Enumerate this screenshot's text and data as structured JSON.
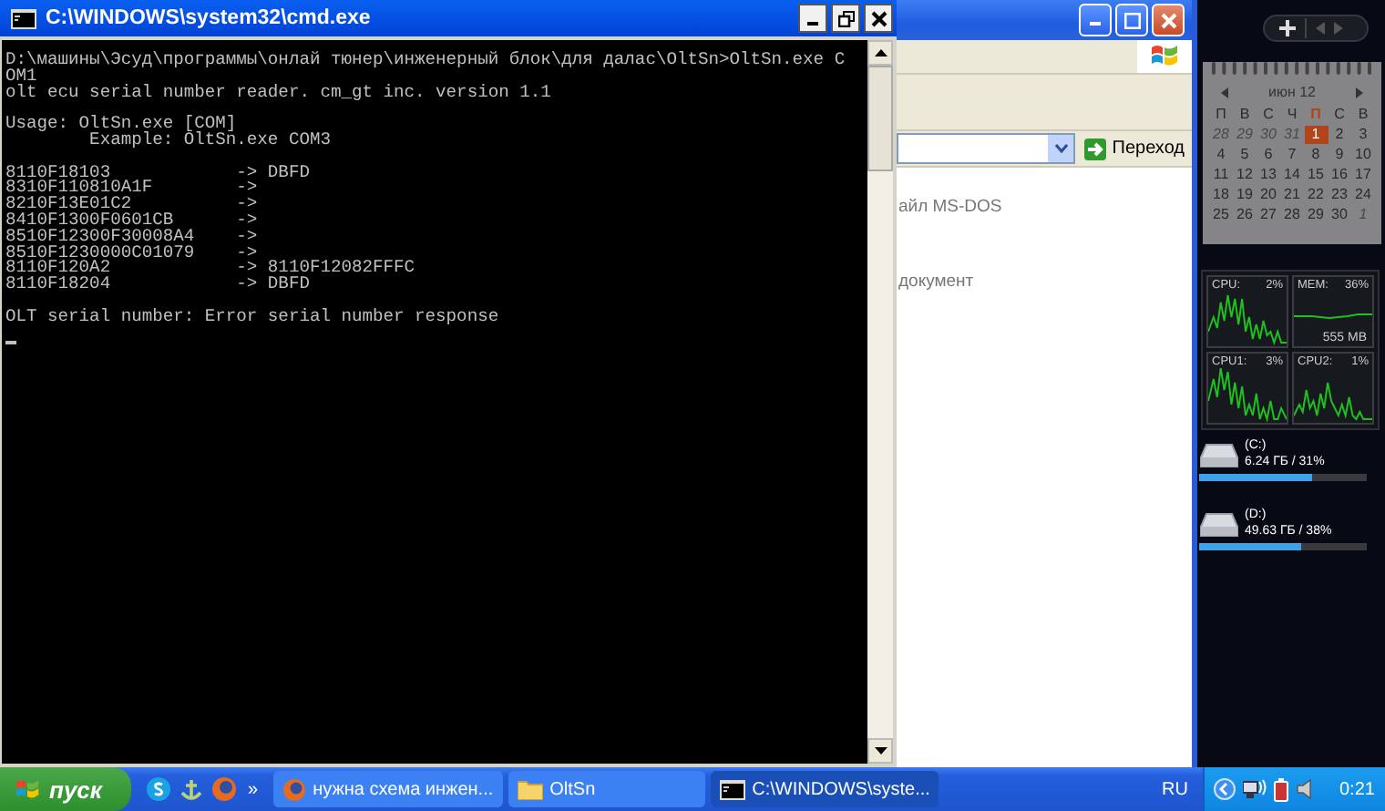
{
  "cmd_window": {
    "title": "C:\\WINDOWS\\system32\\cmd.exe",
    "console_blocks": [
      [
        "D:\\машины\\Эсуд\\программы\\онлай тюнер\\инженерный блок\\для далас\\OltSn>OltSn.exe C",
        "OM1",
        "olt ecu serial number reader. cm_gt inc. version 1.1"
      ],
      [
        "Usage: OltSn.exe [COM]",
        "        Example: OltSn.exe COM3"
      ],
      [
        "8110F18103            -> DBFD",
        "8310F110810A1F        ->",
        "8210F13E01C2          ->",
        "8410F1300F0601CB      ->",
        "8510F12300F30008A4    ->",
        "8510F1230000C01079    ->",
        "8110F120A2            -> 8110F12082FFFC",
        "8110F18204            -> DBFD"
      ],
      [
        "OLT serial number: Error serial number response"
      ]
    ]
  },
  "explorer_window": {
    "go_button": "Переход",
    "items": [
      "айл MS-DOS",
      "документ"
    ]
  },
  "calendar": {
    "month": "июн 12",
    "weekdays": [
      {
        "label": "П",
        "selected": false
      },
      {
        "label": "В",
        "selected": false
      },
      {
        "label": "С",
        "selected": false
      },
      {
        "label": "Ч",
        "selected": false
      },
      {
        "label": "П",
        "selected": true
      },
      {
        "label": "С",
        "selected": false
      },
      {
        "label": "В",
        "selected": false
      }
    ],
    "weeks": [
      [
        {
          "day": "28",
          "muted": true,
          "selected": false
        },
        {
          "day": "29",
          "muted": true,
          "selected": false
        },
        {
          "day": "30",
          "muted": true,
          "selected": false
        },
        {
          "day": "31",
          "muted": true,
          "selected": false
        },
        {
          "day": "1",
          "muted": false,
          "selected": true
        },
        {
          "day": "2",
          "muted": false,
          "selected": false
        },
        {
          "day": "3",
          "muted": false,
          "selected": false
        }
      ],
      [
        {
          "day": "4",
          "muted": false,
          "selected": false
        },
        {
          "day": "5",
          "muted": false,
          "selected": false
        },
        {
          "day": "6",
          "muted": false,
          "selected": false
        },
        {
          "day": "7",
          "muted": false,
          "selected": false
        },
        {
          "day": "8",
          "muted": false,
          "selected": false
        },
        {
          "day": "9",
          "muted": false,
          "selected": false
        },
        {
          "day": "10",
          "muted": false,
          "selected": false
        }
      ],
      [
        {
          "day": "11",
          "muted": false,
          "selected": false
        },
        {
          "day": "12",
          "muted": false,
          "selected": false
        },
        {
          "day": "13",
          "muted": false,
          "selected": false
        },
        {
          "day": "14",
          "muted": false,
          "selected": false
        },
        {
          "day": "15",
          "muted": false,
          "selected": false
        },
        {
          "day": "16",
          "muted": false,
          "selected": false
        },
        {
          "day": "17",
          "muted": false,
          "selected": false
        }
      ],
      [
        {
          "day": "18",
          "muted": false,
          "selected": false
        },
        {
          "day": "19",
          "muted": false,
          "selected": false
        },
        {
          "day": "20",
          "muted": false,
          "selected": false
        },
        {
          "day": "21",
          "muted": false,
          "selected": false
        },
        {
          "day": "22",
          "muted": false,
          "selected": false
        },
        {
          "day": "23",
          "muted": false,
          "selected": false
        },
        {
          "day": "24",
          "muted": false,
          "selected": false
        }
      ],
      [
        {
          "day": "25",
          "muted": false,
          "selected": false
        },
        {
          "day": "26",
          "muted": false,
          "selected": false
        },
        {
          "day": "27",
          "muted": false,
          "selected": false
        },
        {
          "day": "28",
          "muted": false,
          "selected": false
        },
        {
          "day": "29",
          "muted": false,
          "selected": false
        },
        {
          "day": "30",
          "muted": false,
          "selected": false
        },
        {
          "day": "1",
          "muted": true,
          "selected": false
        }
      ]
    ]
  },
  "cpu_meter": {
    "panels": [
      {
        "label": "CPU:",
        "value": "2%"
      },
      {
        "label": "MEM:",
        "value": "36%",
        "detail": "555 MB"
      },
      {
        "label": "CPU1:",
        "value": "3%"
      },
      {
        "label": "CPU2:",
        "value": "1%"
      }
    ]
  },
  "drives": [
    {
      "name": "(C:)",
      "usage": "6.24 ГБ / 31%",
      "level": 0.67
    },
    {
      "name": "(D:)",
      "usage": "49.63 ГБ / 38%",
      "level": 0.61
    }
  ],
  "taskbar": {
    "start_label": "пуск",
    "more": "»",
    "tasks": [
      {
        "kind": "browser",
        "label": "нужна схема инжен...",
        "selected": false
      },
      {
        "kind": "folder",
        "label": "OltSn",
        "selected": false
      },
      {
        "kind": "console",
        "label": "C:\\WINDOWS\\syste...",
        "selected": true
      }
    ],
    "language": "RU",
    "clock": "0:21"
  }
}
